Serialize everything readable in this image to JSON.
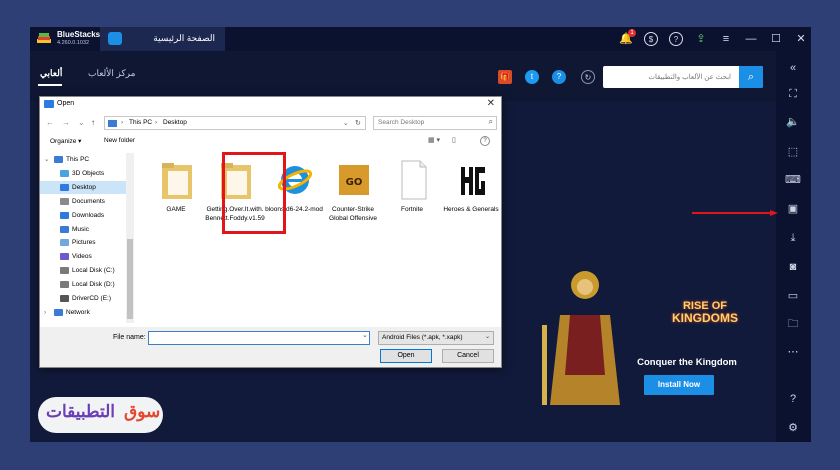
{
  "titlebar": {
    "app_name": "BlueStacks",
    "version": "4.260.0.1032",
    "home_tab": "الصفحة الرئيسية",
    "notification_count": "1"
  },
  "header": {
    "nav_my_games": "ألعابي",
    "nav_game_center": "مركز الألعاب",
    "search_placeholder": "ابحث عن الألعاب والتطبيقات"
  },
  "dialog": {
    "title": "Open",
    "path": [
      "This PC",
      "Desktop"
    ],
    "search_placeholder": "Search Desktop",
    "organize": "Organize ▾",
    "new_folder": "New folder",
    "tree": [
      {
        "label": "This PC",
        "icon": "computer-icon",
        "color": "#3a7bd5"
      },
      {
        "label": "3D Objects",
        "icon": "cube-icon",
        "color": "#4aa3df"
      },
      {
        "label": "Desktop",
        "icon": "desktop-icon",
        "color": "#2d7be0"
      },
      {
        "label": "Documents",
        "icon": "documents-icon",
        "color": "#8a8a8a"
      },
      {
        "label": "Downloads",
        "icon": "download-icon",
        "color": "#2d7be0"
      },
      {
        "label": "Music",
        "icon": "music-icon",
        "color": "#3a7bd5"
      },
      {
        "label": "Pictures",
        "icon": "pictures-icon",
        "color": "#6fa8dc"
      },
      {
        "label": "Videos",
        "icon": "videos-icon",
        "color": "#6a5acd"
      },
      {
        "label": "Local Disk (C:)",
        "icon": "drive-icon",
        "color": "#7a7a7a"
      },
      {
        "label": "Local Disk (D:)",
        "icon": "drive-icon",
        "color": "#7a7a7a"
      },
      {
        "label": "DriverCD (E:)",
        "icon": "cd-icon",
        "color": "#555555"
      },
      {
        "label": "Network",
        "icon": "network-icon",
        "color": "#3a7bd5"
      }
    ],
    "files": [
      {
        "label": "GAME",
        "icon": "folder-icon"
      },
      {
        "label": "Getting.Over.It.with.Bennett.Foddy.v1.59",
        "icon": "folder-icon"
      },
      {
        "label": "bloonstd6-24.2-mod",
        "icon": "internet-explorer-icon"
      },
      {
        "label": "Counter-Strike Global Offensive",
        "icon": "csgo-icon"
      },
      {
        "label": "Fortnite",
        "icon": "blank-file-icon"
      },
      {
        "label": "Heroes & Generals",
        "icon": "hg-icon"
      }
    ],
    "file_name_label": "File name:",
    "file_name_value": "",
    "file_type": "Android Files (*.apk, *.xapk)",
    "open_button": "Open",
    "cancel_button": "Cancel"
  },
  "promo": {
    "game_logo_line1": "RISE OF",
    "game_logo_line2": "KINGDOMS",
    "tagline": "Conquer the Kingdom",
    "install_button": "Install Now"
  },
  "watermark": {
    "main": "التطبيقات",
    "accent": "سوق"
  },
  "colors": {
    "accent": "#1b8fe6",
    "highlight": "#e0161b",
    "background": "#111a3a"
  }
}
